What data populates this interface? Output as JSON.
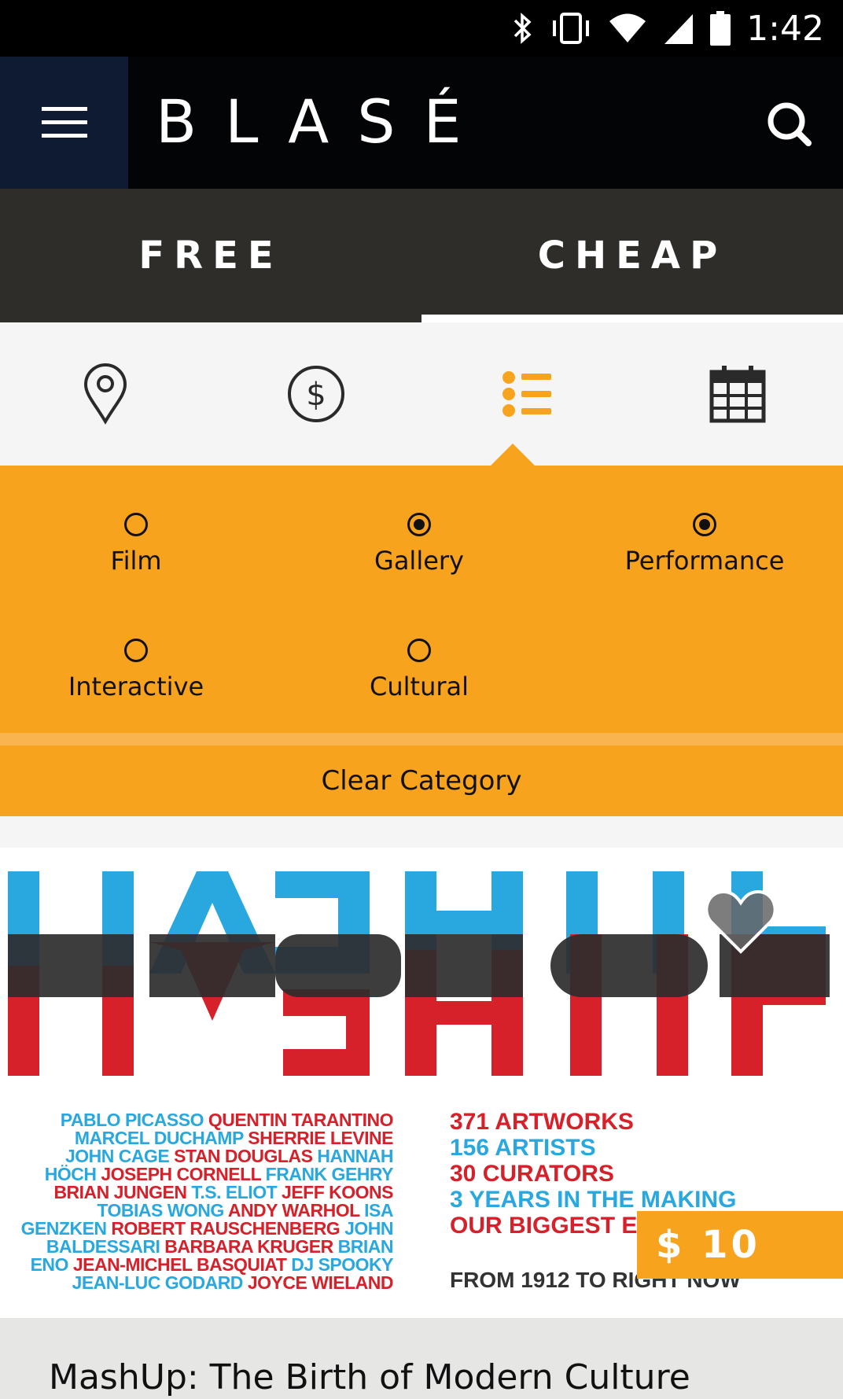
{
  "status_bar": {
    "time": "1:42",
    "icons": [
      "bluetooth-icon",
      "vibrate-icon",
      "wifi-icon",
      "signal-icon",
      "battery-icon"
    ]
  },
  "app_bar": {
    "brand": "BLASÉ",
    "menu_icon": "hamburger-icon",
    "search_icon": "search-icon"
  },
  "tabs": [
    {
      "label": "FREE",
      "active": false
    },
    {
      "label": "CHEAP",
      "active": true
    }
  ],
  "filters": [
    {
      "icon": "location-pin-icon",
      "active": false
    },
    {
      "icon": "dollar-icon",
      "active": false
    },
    {
      "icon": "category-list-icon",
      "active": true
    },
    {
      "icon": "calendar-icon",
      "active": false
    }
  ],
  "categories": [
    {
      "label": "Film",
      "selected": false
    },
    {
      "label": "Gallery",
      "selected": true
    },
    {
      "label": "Performance",
      "selected": true
    },
    {
      "label": "Interactive",
      "selected": false
    },
    {
      "label": "Cultural",
      "selected": false
    }
  ],
  "clear_category": "Clear Category",
  "card": {
    "poster": {
      "title_art": "MASHUP",
      "names": [
        [
          [
            "b",
            "PABLO PICASSO "
          ],
          [
            "r",
            "QUENTIN TARANTINO"
          ]
        ],
        [
          [
            "b",
            "MARCEL DUCHAMP "
          ],
          [
            "r",
            "SHERRIE LEVINE"
          ]
        ],
        [
          [
            "b",
            "JOHN CAGE "
          ],
          [
            "r",
            "STAN DOUGLAS "
          ],
          [
            "b",
            "HANNAH"
          ]
        ],
        [
          [
            "b",
            "HÖCH "
          ],
          [
            "r",
            "JOSEPH CORNELL "
          ],
          [
            "b",
            "FRANK GEHRY"
          ]
        ],
        [
          [
            "r",
            "BRIAN JUNGEN "
          ],
          [
            "b",
            "T.S. ELIOT "
          ],
          [
            "r",
            "JEFF KOONS"
          ]
        ],
        [
          [
            "b",
            "TOBIAS WONG "
          ],
          [
            "r",
            "ANDY WARHOL "
          ],
          [
            "b",
            "ISA"
          ]
        ],
        [
          [
            "b",
            "GENZKEN "
          ],
          [
            "r",
            "ROBERT RAUSCHENBERG "
          ],
          [
            "b",
            "JOHN"
          ]
        ],
        [
          [
            "b",
            "BALDESSARI "
          ],
          [
            "r",
            "BARBARA KRUGER "
          ],
          [
            "b",
            "BRIAN"
          ]
        ],
        [
          [
            "b",
            "ENO "
          ],
          [
            "r",
            "JEAN-MICHEL BASQUIAT "
          ],
          [
            "b",
            "DJ SPOOKY"
          ]
        ],
        [
          [
            "b",
            "JEAN-LUC GODARD "
          ],
          [
            "r",
            "JOYCE WIELAND"
          ]
        ]
      ],
      "stats": [
        {
          "color": "r",
          "text": "371 ARTWORKS"
        },
        {
          "color": "b",
          "text": "156 ARTISTS"
        },
        {
          "color": "r",
          "text": "30 CURATORS"
        },
        {
          "color": "b",
          "text": "3 YEARS IN THE MAKING"
        },
        {
          "color": "r",
          "text": "OUR BIGGEST E"
        }
      ],
      "from_line": "FROM 1912 TO RIGHT NOW"
    },
    "price": "$ 10",
    "favorite_icon": "heart-icon",
    "title": "MashUp: The Birth of Modern Culture"
  },
  "colors": {
    "accent": "#f8a31e",
    "dark": "#2e2d2a",
    "menu_bg": "#0f1b33",
    "poster_blue": "#29a8e0",
    "poster_red": "#d6202a"
  }
}
